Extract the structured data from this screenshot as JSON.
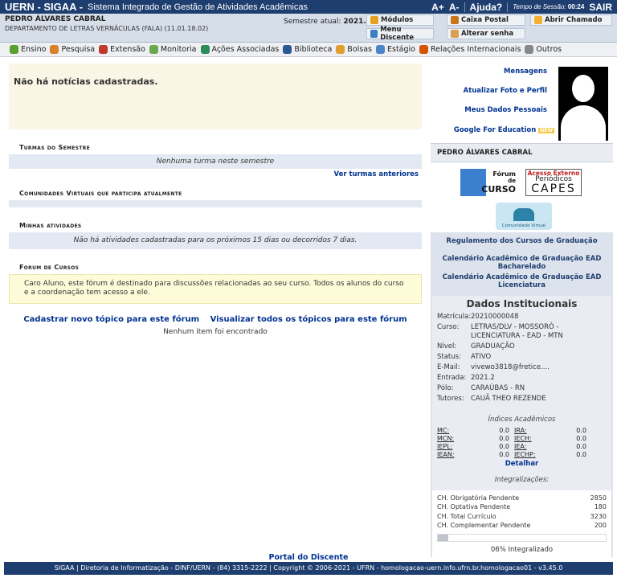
{
  "topbar": {
    "brand": "UERN - SIGAA -",
    "system": "Sistema Integrado de Gestão de Atividades Acadêmicas",
    "font_up": "A+",
    "font_down": "A-",
    "help": "Ajuda?",
    "session_label": "Tempo de Sessão:",
    "session_time": "00:24",
    "logout": "SAIR"
  },
  "user": {
    "name": "PEDRO ÁLVARES CABRAL",
    "department": "DEPARTAMENTO DE LETRAS VERNÁCULAS (FALA) (11.01.18.02)",
    "semester_label": "Semestre atual:",
    "semester": "2021.2"
  },
  "quick": {
    "modules": "Módulos",
    "mailbox": "Caixa Postal",
    "ticket": "Abrir Chamado",
    "student_menu": "Menu Discente",
    "change_password": "Alterar senha"
  },
  "menu": [
    "Ensino",
    "Pesquisa",
    "Extensão",
    "Monitoria",
    "Ações Associadas",
    "Biblioteca",
    "Bolsas",
    "Estágio",
    "Relações Internacionais",
    "Outros"
  ],
  "news": "Não há notícias cadastradas.",
  "turmas": {
    "title": "Turmas do Semestre",
    "empty": "Nenhuma turma neste semestre",
    "link": "Ver turmas anteriores"
  },
  "comunidades": {
    "title": "Comunidades Virtuais que participa atualmente"
  },
  "atividades": {
    "title": "Minhas atividades",
    "empty": "Não há atividades cadastradas para os próximos 15 dias ou decorridos 7 dias."
  },
  "forum": {
    "title": "Forum de Cursos",
    "note": "Caro Aluno, este fórum é destinado para discussões relacionadas ao seu curso. Todos os alunos do curso e a coordenação tem acesso a ele.",
    "new_topic": "Cadastrar novo tópico para este fórum",
    "view_all": "Visualizar todos os tópicos para este fórum",
    "empty": "Nenhum item foi encontrado"
  },
  "side": {
    "messages": "Mensagens",
    "update_photo": "Atualizar Foto e Perfil",
    "my_data": "Meus Dados Pessoais",
    "google": "Google For Education",
    "google_badge": "NEW",
    "name": "PEDRO ÁLVARES CABRAL",
    "forum_logo_1": "Fórum",
    "forum_logo_2": "de",
    "forum_logo_3": "CURSO",
    "capes_1": "Acesso Externo",
    "capes_2": "Periódicos",
    "capes_3": "CAPES",
    "community": "Comunidade Virtual",
    "reg": "Regulamento dos Cursos de Graduação",
    "cal1": "Calendário Acadêmico de Graduação EAD Bacharelado",
    "cal2": "Calendário Acadêmico de Graduação EAD Licenciatura"
  },
  "institutional": {
    "title": "Dados Institucionais",
    "rows": [
      {
        "k": "Matrícula:",
        "v": "20210000048"
      },
      {
        "k": "Curso:",
        "v": "LETRAS/DLV - MOSSORÓ - LICENCIATURA - EAD - MTN"
      },
      {
        "k": "Nível:",
        "v": "GRADUAÇÃO"
      },
      {
        "k": "Status:",
        "v": "ATIVO"
      },
      {
        "k": "E-Mail:",
        "v": "vivewo3818@fretice...."
      },
      {
        "k": "Entrada:",
        "v": "2021.2"
      },
      {
        "k": "Pólo:",
        "v": "CARAÚBAS - RN"
      },
      {
        "k": "Tutores:",
        "v": "CAUÃ THEO REZENDE"
      }
    ],
    "indices_title": "Índices Acadêmicos",
    "indices": [
      {
        "l1": "MC:",
        "v1": "0.0",
        "l2": "IRA:",
        "v2": "0.0"
      },
      {
        "l1": "MCN:",
        "v1": "0.0",
        "l2": "IECH:",
        "v2": "0.0"
      },
      {
        "l1": "IEPL:",
        "v1": "0.0",
        "l2": "IEA:",
        "v2": "0.0"
      },
      {
        "l1": "IEAN:",
        "v1": "0.0",
        "l2": "IECHP:",
        "v2": "0.0"
      }
    ],
    "detail": "Detalhar",
    "integ_title": "Integralizações:",
    "integ": [
      {
        "k": "CH. Obrigatória Pendente",
        "v": "2850"
      },
      {
        "k": "CH. Optativa Pendente",
        "v": "180"
      },
      {
        "k": "CH. Total Currículo",
        "v": "3230"
      },
      {
        "k": "CH. Complementar Pendente",
        "v": "200"
      }
    ],
    "progress": 6,
    "progress_label": "06% Integralizado"
  },
  "portal": "Portal do Discente",
  "footer": "SIGAA | Diretoria de Informatização - DINF/UERN - (84) 3315-2222 | Copyright © 2006-2021 - UFRN - homologacao-uern.info.ufrn.br.homologacao01 - v3.45.0",
  "colors": {
    "header": "#1e3e6f",
    "link": "#003390",
    "news_bg": "#fbf5e5",
    "side_bg": "#dde3ec"
  }
}
